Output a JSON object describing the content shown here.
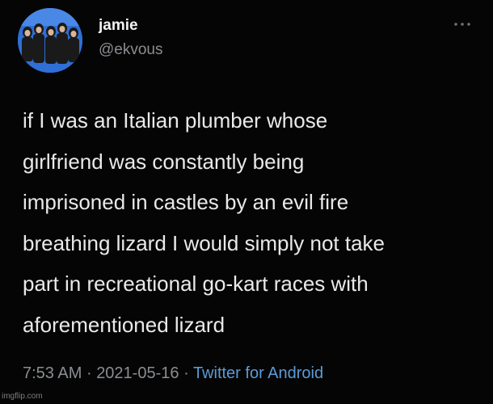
{
  "user": {
    "display_name": "jamie",
    "handle": "@ekvous"
  },
  "tweet": {
    "lines": [
      "if I was an Italian plumber whose",
      "girlfriend was constantly being",
      "imprisoned in castles by an evil fire",
      "breathing lizard I would simply not take",
      "part in recreational go-kart races with",
      "aforementioned lizard"
    ],
    "time": "7:53 AM",
    "separator": "·",
    "date": "2021-05-16",
    "source": "Twitter for Android"
  },
  "icons": {
    "avatar": "avatar-photo",
    "more": "more-dots-icon"
  },
  "watermark": "imgflip.com",
  "colors": {
    "background": "#050505",
    "text": "#e9e9e9",
    "secondary_text": "#8a8d91",
    "link": "#5b9bd9",
    "avatar_bg": "#2f6fd6"
  }
}
